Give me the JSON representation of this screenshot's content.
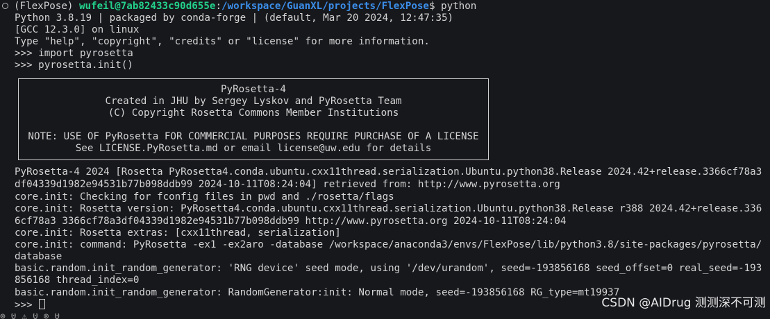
{
  "prompt": {
    "env": "(FlexPose) ",
    "user_host": "wufeil@7ab82433c90d655e",
    "sep": ":",
    "path": "/workspace/GuanXL/projects/FlexPose",
    "cmd": "$ python"
  },
  "python_banner": [
    "Python 3.8.19 | packaged by conda-forge | (default, Mar 20 2024, 12:47:35)",
    "[GCC 12.3.0] on linux",
    "Type \"help\", \"copyright\", \"credits\" or \"license\" for more information.",
    ">>> import pyrosetta",
    ">>> pyrosetta.init()"
  ],
  "license_box": [
    "PyRosetta-4",
    "Created in JHU by Sergey Lyskov and PyRosetta Team",
    "(C) Copyright Rosetta Commons Member Institutions",
    "",
    "NOTE: USE OF PyRosetta FOR COMMERCIAL PURPOSES REQUIRE PURCHASE OF A LICENSE",
    "See LICENSE.PyRosetta.md or email license@uw.edu for details"
  ],
  "log": [
    "PyRosetta-4 2024 [Rosetta PyRosetta4.conda.ubuntu.cxx11thread.serialization.Ubuntu.python38.Release 2024.42+release.3366cf78a3",
    "df04339d1982e94531b77b098ddb99 2024-10-11T08:24:04] retrieved from: http://www.pyrosetta.org",
    "core.init: Checking for fconfig files in pwd and ./rosetta/flags",
    "core.init: Rosetta version: PyRosetta4.conda.ubuntu.cxx11thread.serialization.Ubuntu.python38.Release r388 2024.42+release.336",
    "6cf78a3 3366cf78a3df04339d1982e94531b77b098ddb99 http://www.pyrosetta.org 2024-10-11T08:24:04",
    "core.init: Rosetta extras: [cxx11thread, serialization]",
    "core.init: command: PyRosetta -ex1 -ex2aro -database /workspace/anaconda3/envs/FlexPose/lib/python3.8/site-packages/pyrosetta/",
    "database",
    "basic.random.init_random_generator: 'RNG device' seed mode, using '/dev/urandom', seed=-193856168 seed_offset=0 real_seed=-193",
    "856168 thread_index=0",
    "basic.random.init_random_generator: RandomGenerator:init: Normal mode, seed=-193856168 RG_type=mt19937"
  ],
  "current_prompt": ">>> ",
  "watermark": "CSDN @AIDrug 测测深不可测",
  "status_bar": "⊗ 0 ⚠ 0   ⊗ 0"
}
